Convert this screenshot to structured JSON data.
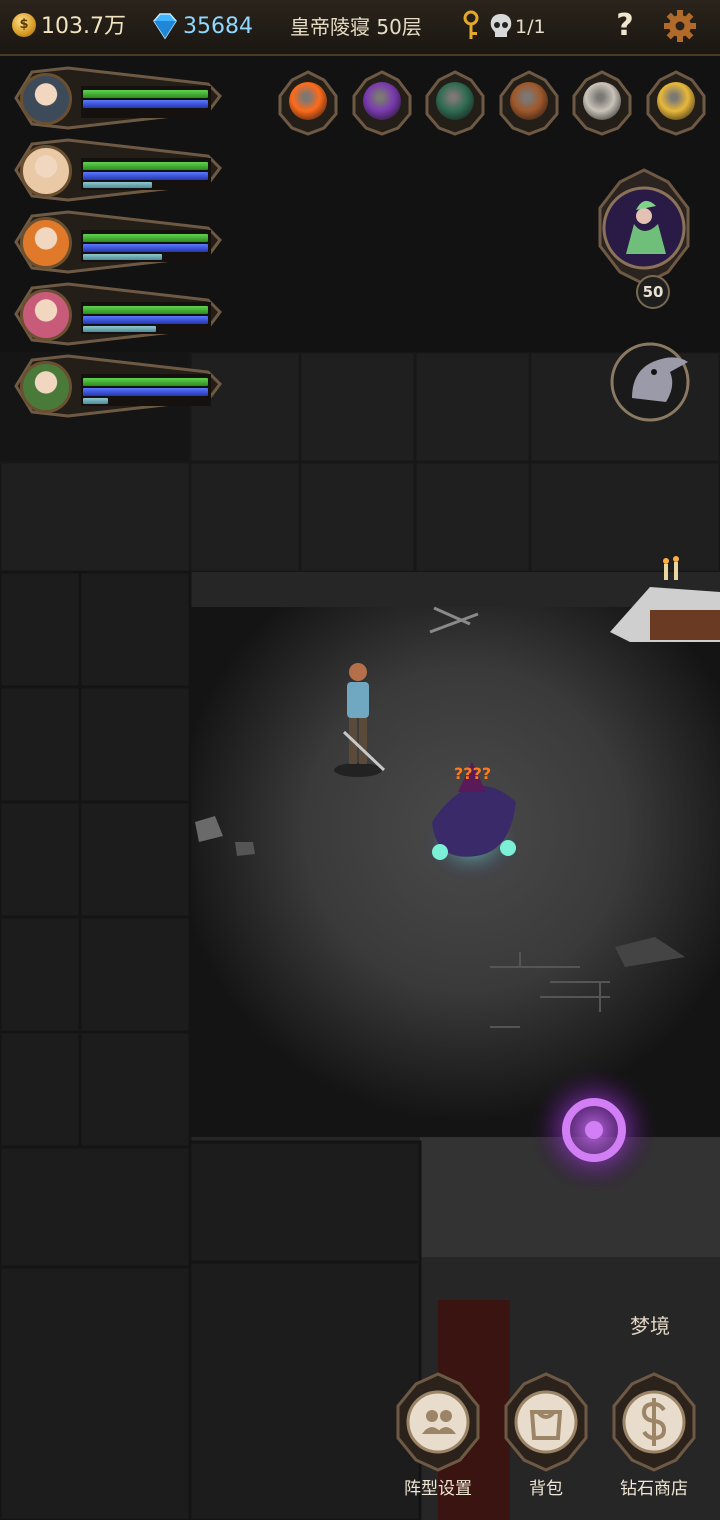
{
  "topbar": {
    "gold": "103.7万",
    "gems": "35684",
    "floor": "皇帝陵寝 50层",
    "kills": "1/1",
    "help": "?",
    "coin_symbol": "$",
    "icons": [
      "coin-icon",
      "diamond-icon",
      "key-icon",
      "skull-icon",
      "help-icon",
      "gear-icon"
    ]
  },
  "party": [
    {
      "name": "wolf-hero",
      "hp": 1.0,
      "mp": 1.0,
      "xp": 0.0,
      "portrait_color": "#3d4a5a"
    },
    {
      "name": "blonde-hero",
      "hp": 1.0,
      "mp": 1.0,
      "xp": 0.55,
      "portrait_color": "#e9c9a6"
    },
    {
      "name": "witch-hero",
      "hp": 1.0,
      "mp": 1.0,
      "xp": 0.63,
      "portrait_color": "#e07a2a"
    },
    {
      "name": "flower-hero",
      "hp": 1.0,
      "mp": 1.0,
      "xp": 0.58,
      "portrait_color": "#c85a7a"
    },
    {
      "name": "archer-hero",
      "hp": 1.0,
      "mp": 1.0,
      "xp": 0.2,
      "portrait_color": "#4a7a3a"
    }
  ],
  "skills": [
    {
      "name": "fire-orb-icon",
      "color": "#ff6a1a"
    },
    {
      "name": "spellbook-icon",
      "color": "#7a3ab0"
    },
    {
      "name": "flute-icon",
      "color": "#2f6b52"
    },
    {
      "name": "coffin-icon",
      "color": "#a0582a"
    },
    {
      "name": "white-beast-icon",
      "color": "#c9c3b8"
    },
    {
      "name": "golden-feather-icon",
      "color": "#e8b83a"
    }
  ],
  "boss": {
    "level": "50"
  },
  "enemy": {
    "label": "????"
  },
  "menu": {
    "dream": "梦境",
    "formation": "阵型设置",
    "backpack": "背包",
    "diamond_shop": "钻石商店"
  }
}
